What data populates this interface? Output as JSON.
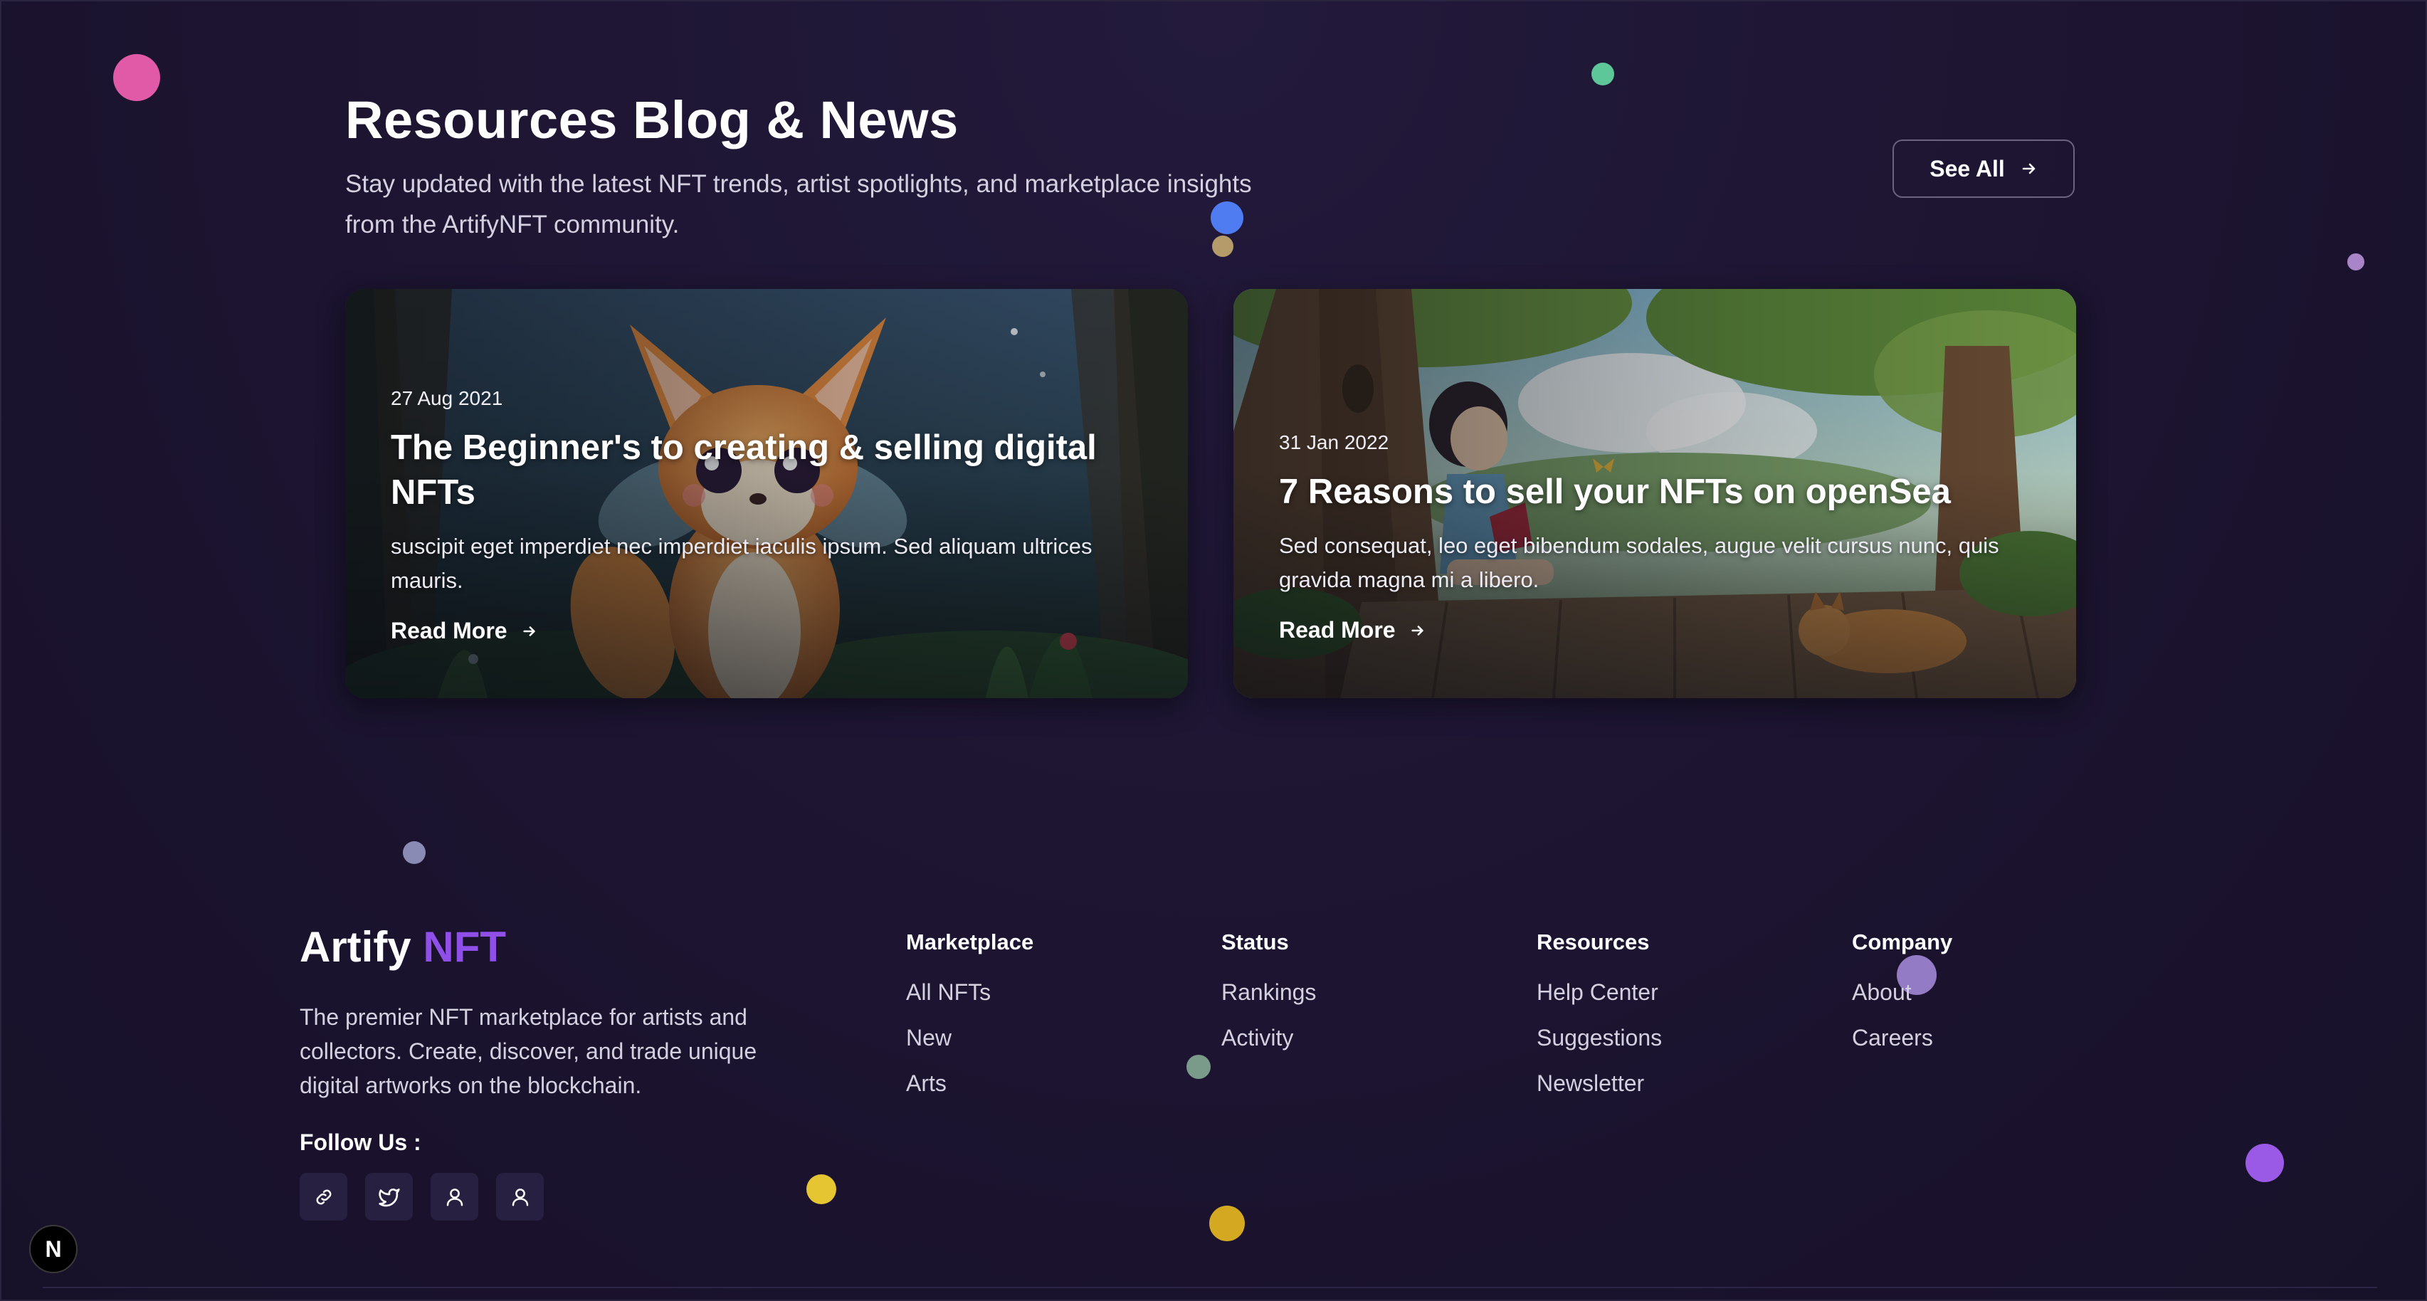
{
  "blog": {
    "title": "Resources Blog & News",
    "subtitle": "Stay updated with the latest NFT trends, artist spotlights, and marketplace insights from the ArtifyNFT community.",
    "see_all_label": "See All",
    "posts": [
      {
        "date": "27 Aug 2021",
        "title": "The Beginner's to creating & selling digital NFTs",
        "excerpt": "suscipit eget imperdiet nec imperdiet iaculis ipsum. Sed aliquam ultrices mauris.",
        "read_more": "Read More"
      },
      {
        "date": "31 Jan 2022",
        "title": "7 Reasons to sell your NFTs on openSea",
        "excerpt": "Sed consequat, leo eget bibendum sodales, augue velit cursus nunc, quis gravida magna mi a libero.",
        "read_more": "Read More"
      }
    ]
  },
  "footer": {
    "brand_main": "Artify",
    "brand_accent": "NFT",
    "description": "The premier NFT marketplace for artists and collectors. Create, discover, and trade unique digital artworks on the blockchain.",
    "follow_label": "Follow Us :",
    "socials": [
      "link-icon",
      "twitter-icon",
      "user-icon",
      "user-icon"
    ],
    "columns": [
      {
        "heading": "Marketplace",
        "links": [
          "All NFTs",
          "New",
          "Arts"
        ]
      },
      {
        "heading": "Status",
        "links": [
          "Rankings",
          "Activity"
        ]
      },
      {
        "heading": "Resources",
        "links": [
          "Help Center",
          "Suggestions",
          "Newsletter"
        ]
      },
      {
        "heading": "Company",
        "links": [
          "About",
          "Careers"
        ]
      }
    ]
  },
  "dev_badge": "N",
  "colors": {
    "background": "#1c1430",
    "accent": "#8f4fe8",
    "text_muted": "#d4d0df"
  }
}
